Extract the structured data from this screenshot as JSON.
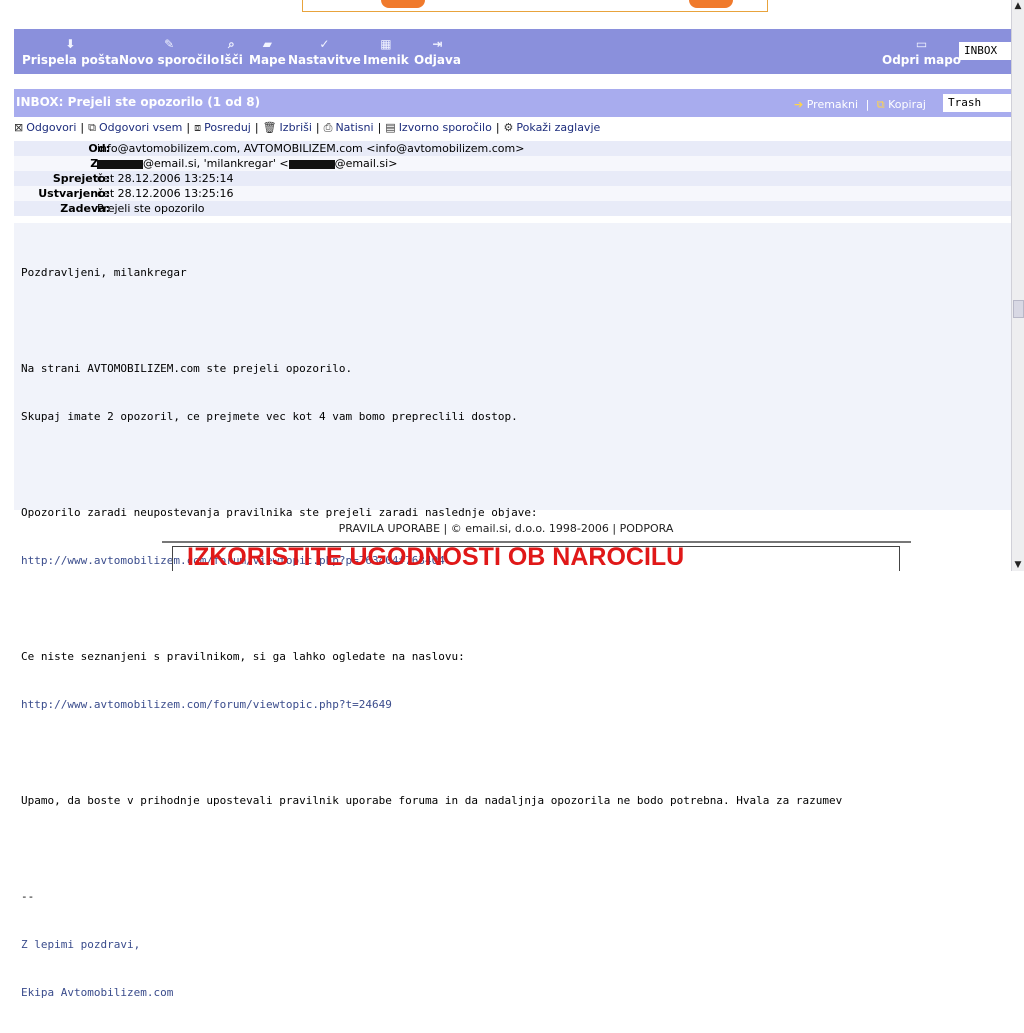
{
  "toolbar": {
    "items": [
      {
        "label": "Prispela pošta",
        "icon": "inbox-icon"
      },
      {
        "label": "Novo sporočilo",
        "icon": "compose-icon"
      },
      {
        "label": "Išči",
        "icon": "search-icon"
      },
      {
        "label": "Mape",
        "icon": "folder-icon"
      },
      {
        "label": "Nastavitve",
        "icon": "settings-icon"
      },
      {
        "label": "Imenik",
        "icon": "addressbook-icon"
      },
      {
        "label": "Odjava",
        "icon": "logout-icon"
      }
    ],
    "open_folder_label": "Odpri mapo",
    "folder_value": "INBOX"
  },
  "message_bar": {
    "title": "INBOX: Prejeli ste opozorilo (1 od 8)",
    "move_label": "Premakni",
    "copy_label": "Kopiraj",
    "target_folder": "Trash"
  },
  "actions": [
    {
      "label": "Odgovori",
      "icon": "reply-icon"
    },
    {
      "label": "Odgovori vsem",
      "icon": "reply-all-icon"
    },
    {
      "label": "Posreduj",
      "icon": "forward-icon"
    },
    {
      "label": "Izbriši",
      "icon": "trash-icon"
    },
    {
      "label": "Natisni",
      "icon": "print-icon"
    },
    {
      "label": "Izvorno sporočilo",
      "icon": "source-icon"
    },
    {
      "label": "Pokaži zaglavje",
      "icon": "headers-icon"
    }
  ],
  "headers": {
    "from_label": "Od:",
    "from_value": "info@avtomobilizem.com, AVTOMOBILIZEM.com <info@avtomobilizem.com>",
    "to_label": "Za:",
    "to_part1": "@email.si, 'milankregar' <",
    "to_part2": "@email.si>",
    "received_label": "Sprejeto:",
    "received_value": "čet 28.12.2006 13:25:14",
    "created_label": "Ustvarjeno:",
    "created_value": "čet 28.12.2006 13:25:16",
    "subject_label": "Zadeva:",
    "subject_value": "Prejeli ste opozorilo"
  },
  "body": {
    "greeting": "Pozdravljeni, milankregar",
    "line1": "Na strani AVTOMOBILIZEM.com ste prejeli opozorilo.",
    "line2": "Skupaj imate 2 opozoril, ce prejmete vec kot 4 vam bomo prepreclili dostop.",
    "line3": "Opozorilo zaradi neupostevanja pravilnika ste prejeli zaradi naslednje objave:",
    "url1": "http://www.avtomobilizem.com/forum/viewtopic.php?p=763404#763404",
    "line4": "Ce niste seznanjeni s pravilnikom, si ga lahko ogledate na naslovu:",
    "url2": "http://www.avtomobilizem.com/forum/viewtopic.php?t=24649",
    "line5": "Upamo, da boste v prihodnje upostevali pravilnik uporabe foruma in da nadaljnja opozorila ne bodo potrebna. Hvala za razumev",
    "sig_sep": "--",
    "sig1": "Z lepimi pozdravi,",
    "sig2": "Ekipa Avtomobilizem.com"
  },
  "footer": {
    "terms": "PRAVILA UPORABE",
    "copyright": "© email.si, d.o.o. 1998-2006",
    "support": "PODPORA"
  },
  "ad": {
    "text": "IZKORISTITE UGODNOSTI OB NAROČILU"
  }
}
